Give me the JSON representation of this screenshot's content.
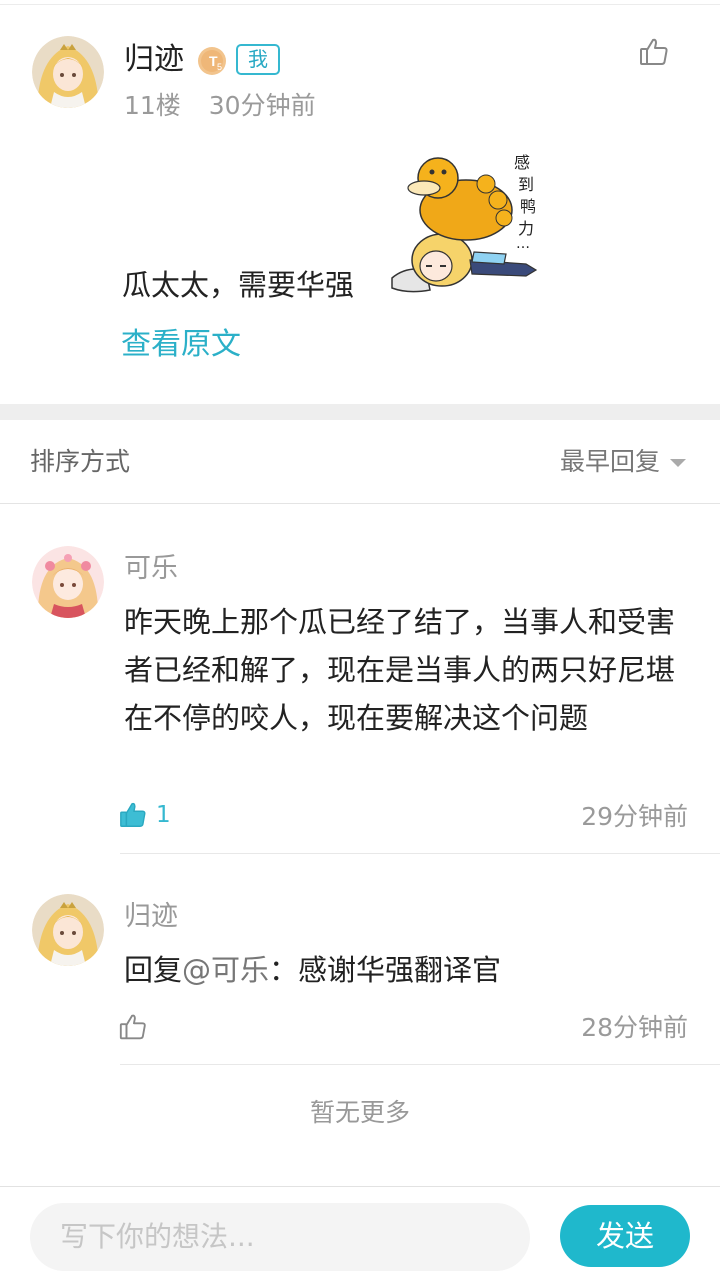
{
  "post": {
    "author": "归迹",
    "level_badge": "T5",
    "me_badge": "我",
    "floor": "11楼",
    "time": "30分钟前",
    "text": "瓜太太，需要华强",
    "sticker_caption": "感到鸭力…",
    "view_original": "查看原文"
  },
  "sort": {
    "label": "排序方式",
    "value": "最早回复"
  },
  "comments": [
    {
      "author": "可乐",
      "text": "昨天晚上那个瓜已经了结了，当事人和受害者已经和解了，现在是当事人的两只好尼堪在不停的咬人，现在要解决这个问题",
      "likes": "1",
      "liked": true,
      "time": "29分钟前"
    },
    {
      "author": "归迹",
      "reply_prefix": "回复",
      "mention": "@可乐",
      "reply_text": "：感谢华强翻译官",
      "likes": "",
      "liked": false,
      "time": "28分钟前"
    }
  ],
  "no_more": "暂无更多",
  "composer": {
    "placeholder": "写下你的想法...",
    "send_label": "发送"
  },
  "colors": {
    "accent": "#1fb8cc",
    "link": "#2bb0c8",
    "muted": "#9a9a9a"
  }
}
